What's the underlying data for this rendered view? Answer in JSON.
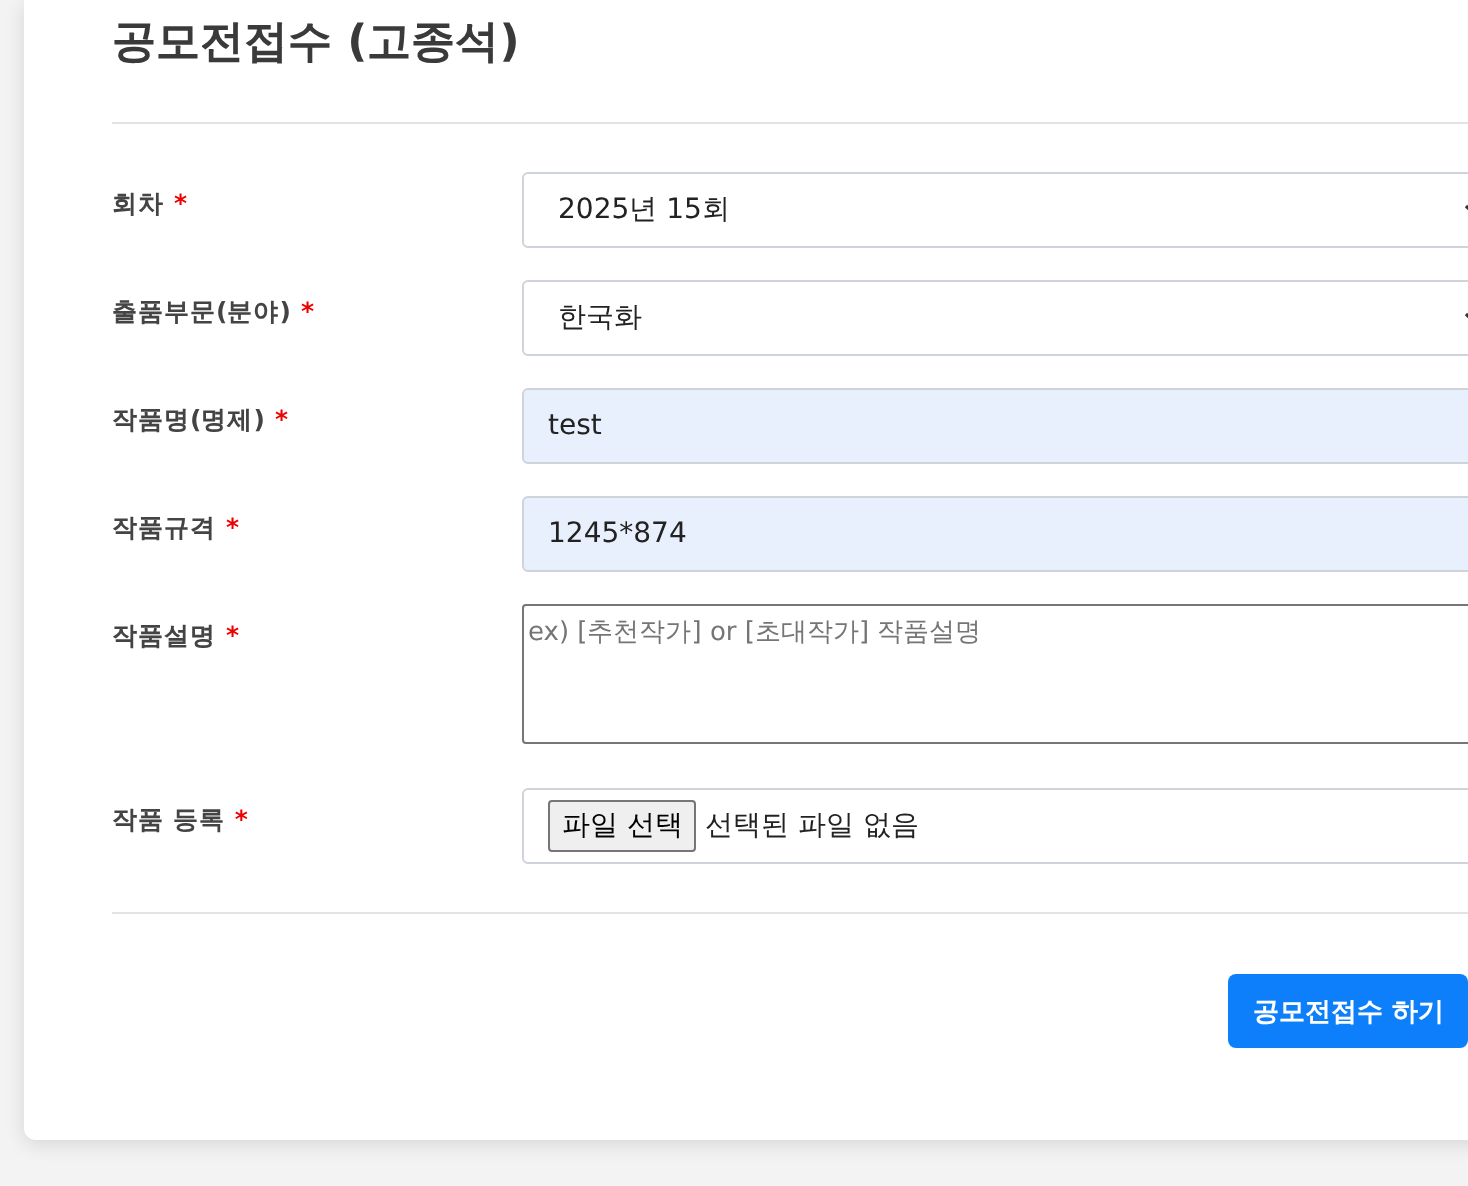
{
  "title": "공모전접수 (고종석)",
  "fields": [
    {
      "kind": "select",
      "label": "회차",
      "required_mark": "*",
      "value": "2025년 15회",
      "autofilled": false
    },
    {
      "kind": "select",
      "label": "출품부문(분야)",
      "required_mark": "*",
      "value": "한국화",
      "autofilled": false
    },
    {
      "kind": "text",
      "label": "작품명(명제)",
      "required_mark": "*",
      "value": "test",
      "autofilled": true
    },
    {
      "kind": "text",
      "label": "작품규격",
      "required_mark": "*",
      "value": "1245*874",
      "autofilled": true
    },
    {
      "kind": "textarea",
      "label": "작품설명",
      "required_mark": "*",
      "placeholder": "ex) [추천작가] or [초대작가] 작품설명",
      "autofilled": false
    },
    {
      "kind": "file",
      "label": "작품 등록",
      "required_mark": "*",
      "button": "파일 선택",
      "status": "선택된 파일 없음",
      "autofilled": false
    }
  ],
  "submit": "공모전접수 하기"
}
